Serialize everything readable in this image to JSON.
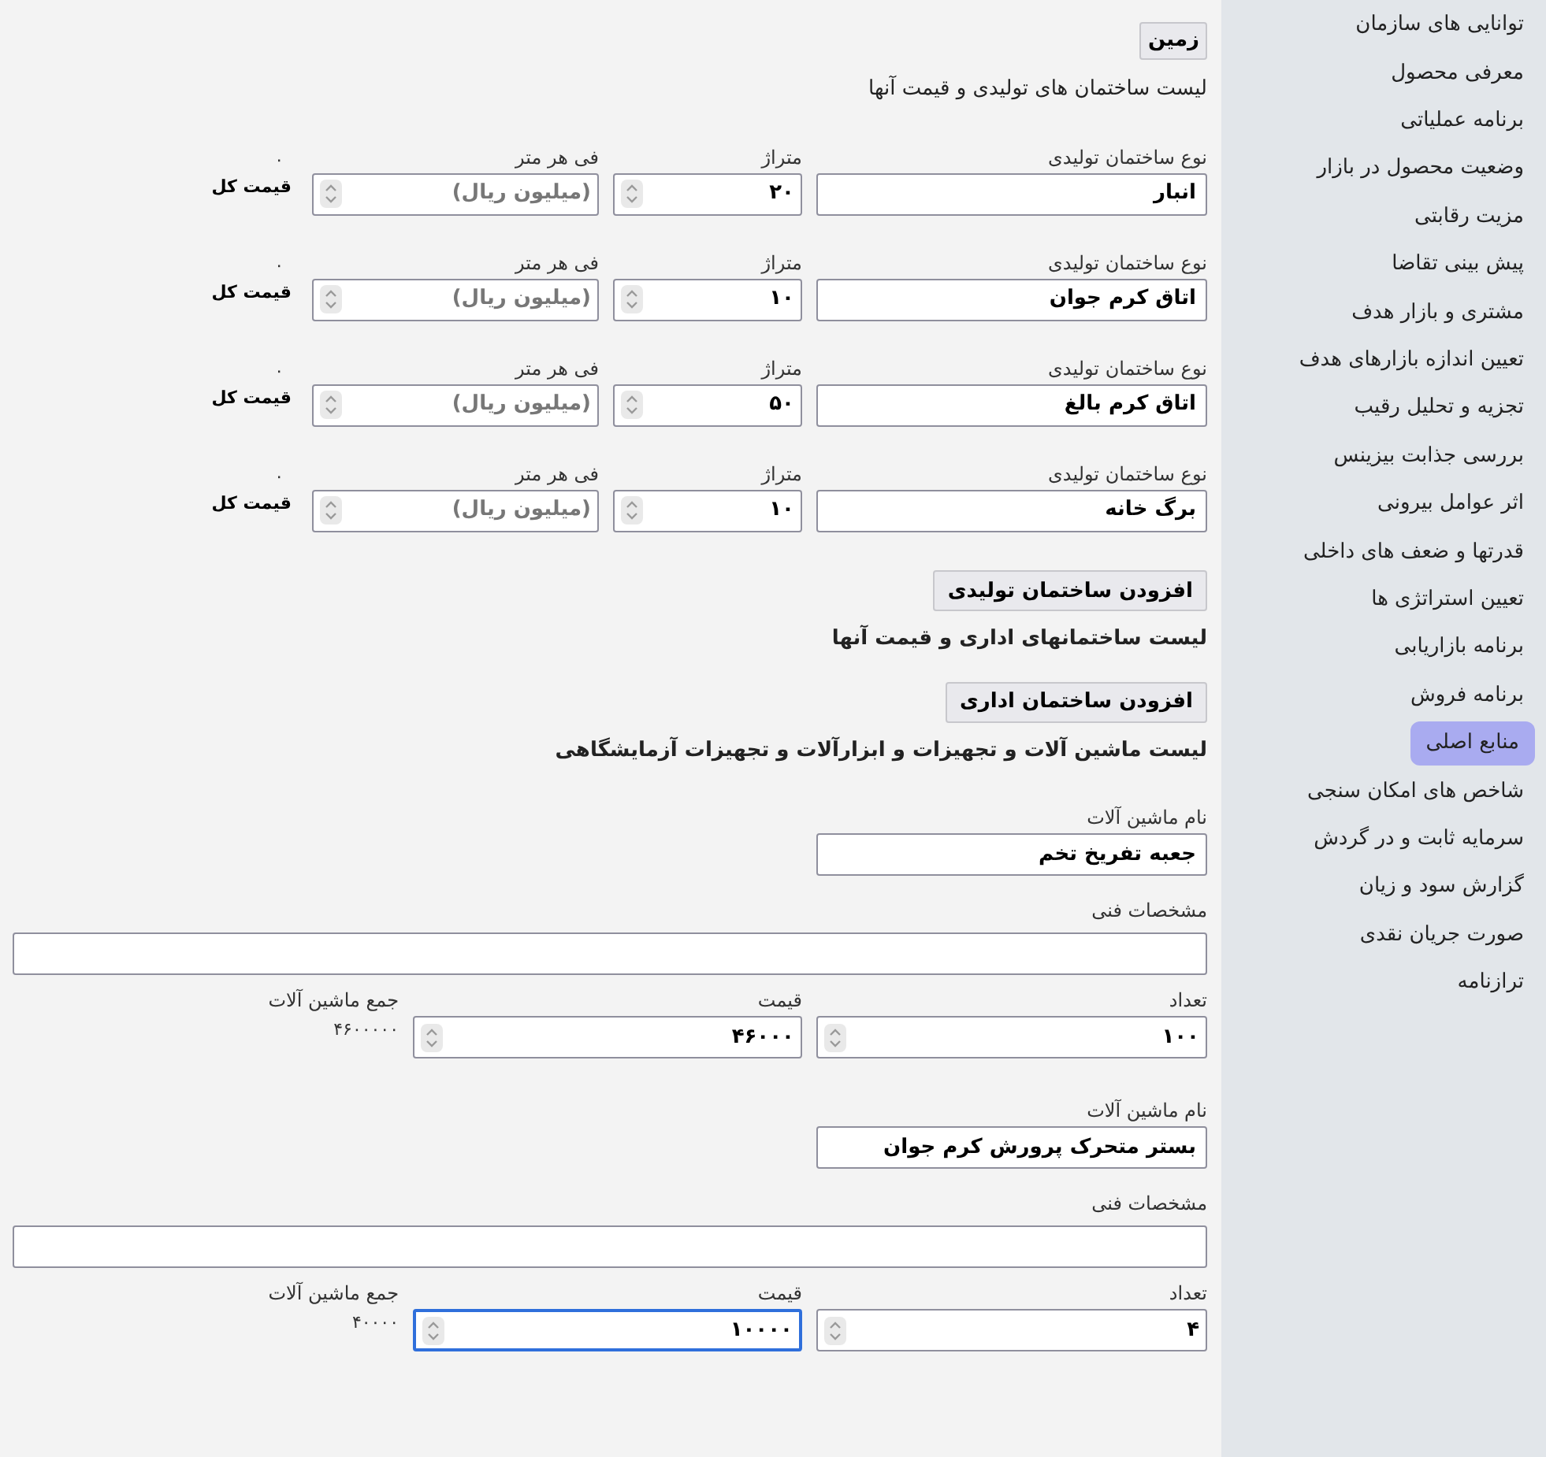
{
  "sidebar": {
    "items": [
      {
        "label": "توانایی های سازمان",
        "selected": false
      },
      {
        "label": "معرفی محصول",
        "selected": false
      },
      {
        "label": "برنامه عملیاتی",
        "selected": false
      },
      {
        "label": "وضعیت محصول در بازار",
        "selected": false
      },
      {
        "label": "مزیت رقابتی",
        "selected": false
      },
      {
        "label": "پیش بینی تقاضا",
        "selected": false
      },
      {
        "label": "مشتری و بازار هدف",
        "selected": false
      },
      {
        "label": "تعیین اندازه بازارهای هدف",
        "selected": false
      },
      {
        "label": "تجزیه و تحلیل رقیب",
        "selected": false
      },
      {
        "label": "بررسی جذابت بیزینس",
        "selected": false
      },
      {
        "label": "اثر عوامل بیرونی",
        "selected": false
      },
      {
        "label": "قدرتها و ضعف های داخلی",
        "selected": false
      },
      {
        "label": "تعیین استراتژی ها",
        "selected": false
      },
      {
        "label": "برنامه بازاریابی",
        "selected": false
      },
      {
        "label": "برنامه فروش",
        "selected": false
      },
      {
        "label": "منابع اصلی",
        "selected": true
      },
      {
        "label": "شاخص های امکان سنجی",
        "selected": false
      },
      {
        "label": "سرمایه ثابت و در گردش",
        "selected": false
      },
      {
        "label": "گزارش سود و زیان",
        "selected": false
      },
      {
        "label": "صورت جریان نقدی",
        "selected": false
      },
      {
        "label": "ترازنامه",
        "selected": false
      }
    ]
  },
  "land_button": "زمین",
  "production": {
    "title": "لیست ساختمان های تولیدی و قیمت آنها",
    "rows": [
      {
        "type_label": "نوع ساختمان تولیدی",
        "type_value": "انبار",
        "area_label": "متراژ",
        "area_value": "۲۰",
        "price_label": "فی هر متر",
        "price_placeholder": "(میلیون ریال)",
        "total_value": "۰",
        "total_label": "قیمت کل"
      },
      {
        "type_label": "نوع ساختمان تولیدی",
        "type_value": "اتاق کرم جوان",
        "area_label": "متراژ",
        "area_value": "۱۰",
        "price_label": "فی هر متر",
        "price_placeholder": "(میلیون ریال)",
        "total_value": "۰",
        "total_label": "قیمت کل"
      },
      {
        "type_label": "نوع ساختمان تولیدی",
        "type_value": "اتاق کرم بالغ",
        "area_label": "متراژ",
        "area_value": "۵۰",
        "price_label": "فی هر متر",
        "price_placeholder": "(میلیون ریال)",
        "total_value": "۰",
        "total_label": "قیمت کل"
      },
      {
        "type_label": "نوع ساختمان تولیدی",
        "type_value": "برگ خانه",
        "area_label": "متراژ",
        "area_value": "۱۰",
        "price_label": "فی هر متر",
        "price_placeholder": "(میلیون ریال)",
        "total_value": "۰",
        "total_label": "قیمت کل"
      }
    ],
    "add_button": "افزودن ساختمان تولیدی"
  },
  "office": {
    "title": "لیست ساختمانهای اداری و قیمت آنها",
    "add_button": "افزودن ساختمان اداری"
  },
  "machinery": {
    "title": "لیست ماشین آلات و تجهیزات و ابزارآلات و تجهیزات آزمایشگاهی",
    "items": [
      {
        "name_label": "نام ماشین آلات",
        "name_value": "جعبه تفریخ تخم",
        "spec_label": "مشخصات فنی",
        "count_label": "تعداد",
        "count_value": "۱۰۰",
        "price_label": "قیمت",
        "price_value": "۴۶۰۰۰",
        "price_focused": false,
        "total_label": "جمع ماشین آلات",
        "total_value": "۴۶۰۰۰۰۰"
      },
      {
        "name_label": "نام ماشین آلات",
        "name_value": "بستر متحرک پرورش کرم جوان",
        "spec_label": "مشخصات فنی",
        "count_label": "تعداد",
        "count_value": "۴",
        "price_label": "قیمت",
        "price_value": "۱۰۰۰۰",
        "price_focused": true,
        "total_label": "جمع ماشین آلات",
        "total_value": "۴۰۰۰۰"
      }
    ]
  }
}
